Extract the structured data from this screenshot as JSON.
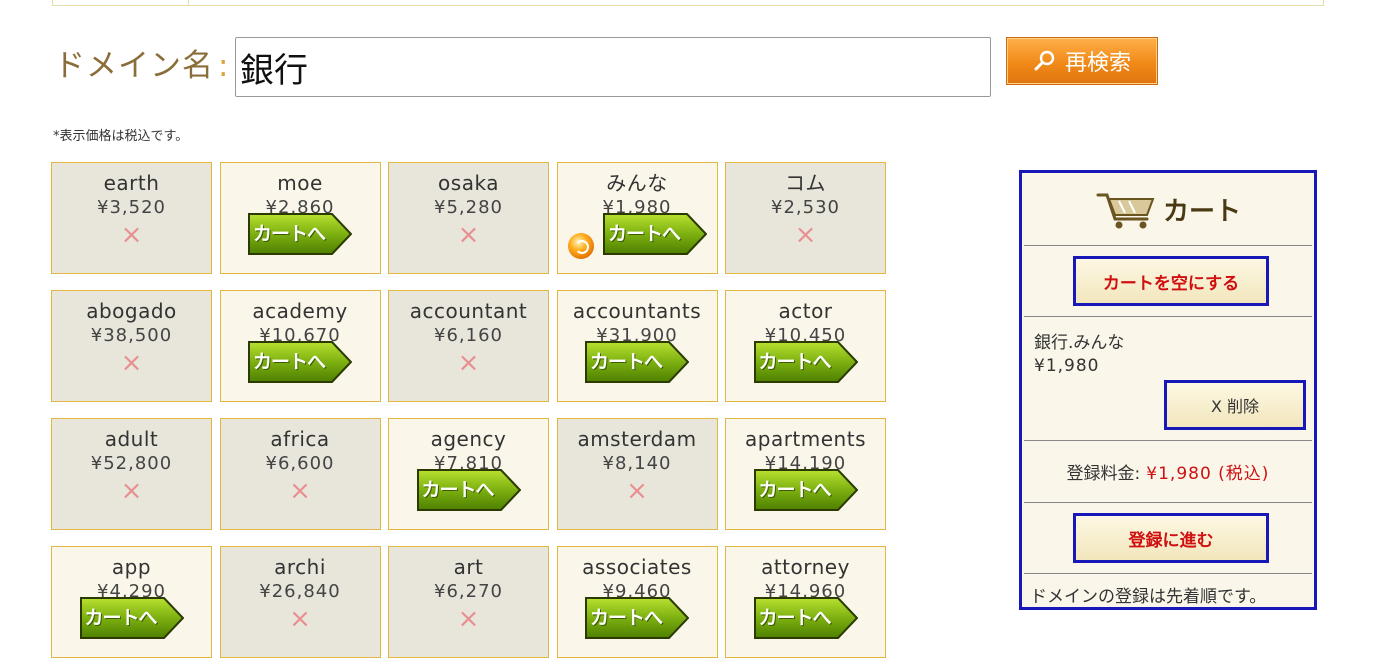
{
  "search": {
    "label": "ドメイン名",
    "colon": ":",
    "value": "銀行",
    "button_label": "再検索"
  },
  "tax_note": "*表示価格は税込です。",
  "cart_button_label": "カートへ",
  "unavailable_mark": "×",
  "domains": [
    {
      "name": "earth",
      "price": "¥3,520",
      "available": false
    },
    {
      "name": "moe",
      "price": "¥2,860",
      "available": true
    },
    {
      "name": "osaka",
      "price": "¥5,280",
      "available": false
    },
    {
      "name": "みんな",
      "price": "¥1,980",
      "available": true,
      "in_cart": true
    },
    {
      "name": "コム",
      "price": "¥2,530",
      "available": false
    },
    {
      "name": "abogado",
      "price": "¥38,500",
      "available": false
    },
    {
      "name": "academy",
      "price": "¥10,670",
      "available": true
    },
    {
      "name": "accountant",
      "price": "¥6,160",
      "available": false
    },
    {
      "name": "accountants",
      "price": "¥31,900",
      "available": true
    },
    {
      "name": "actor",
      "price": "¥10,450",
      "available": true
    },
    {
      "name": "adult",
      "price": "¥52,800",
      "available": false
    },
    {
      "name": "africa",
      "price": "¥6,600",
      "available": false
    },
    {
      "name": "agency",
      "price": "¥7,810",
      "available": true
    },
    {
      "name": "amsterdam",
      "price": "¥8,140",
      "available": false
    },
    {
      "name": "apartments",
      "price": "¥14,190",
      "available": true
    },
    {
      "name": "app",
      "price": "¥4,290",
      "available": true
    },
    {
      "name": "archi",
      "price": "¥26,840",
      "available": false
    },
    {
      "name": "art",
      "price": "¥6,270",
      "available": false
    },
    {
      "name": "associates",
      "price": "¥9,460",
      "available": true
    },
    {
      "name": "attorney",
      "price": "¥14,960",
      "available": true
    }
  ],
  "cart": {
    "title": "カート",
    "empty_button": "カートを空にする",
    "item_domain": "銀行.みんな",
    "item_price": "¥1,980",
    "delete_button": "X 削除",
    "fee_label": "登録料金:",
    "fee_value": "¥1,980 (税込)",
    "register_button": "登録に進む",
    "note": "ドメインの登録は先着順です。"
  },
  "colors": {
    "accent_orange": "#f08a18",
    "cart_border": "#1818b8",
    "price_red": "#d01010",
    "cell_border": "#e3b842"
  }
}
